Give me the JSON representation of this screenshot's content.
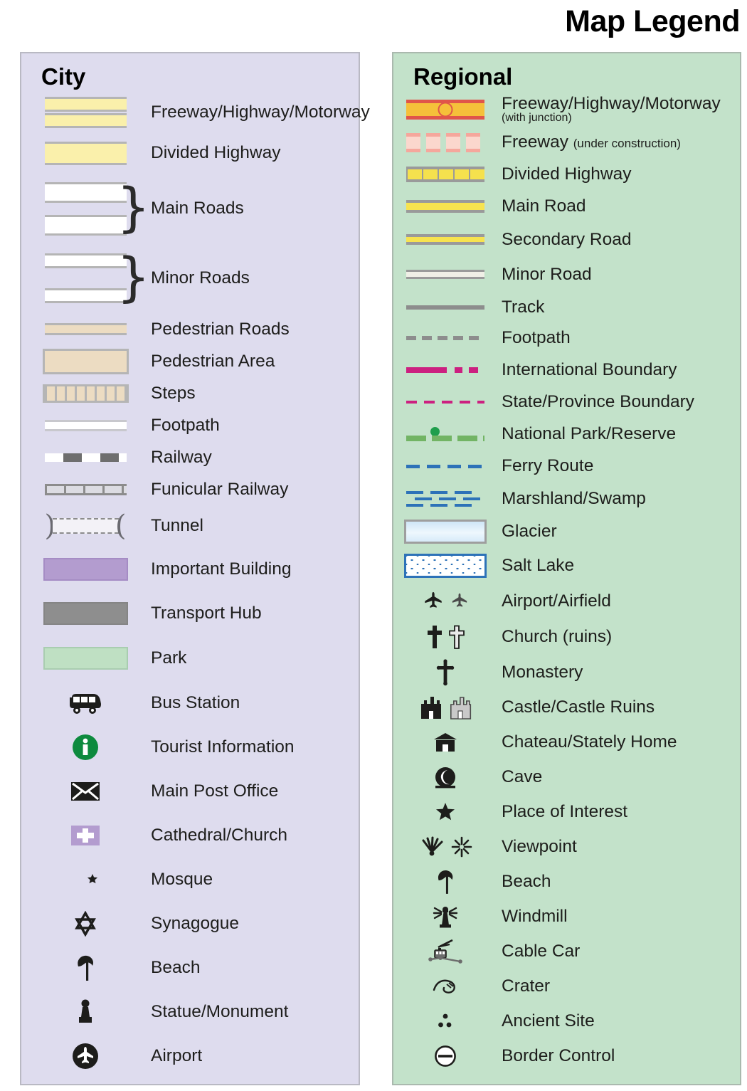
{
  "title": "Map Legend",
  "city": {
    "heading": "City",
    "bg_color": "#dedcee",
    "items": [
      {
        "label": "Freeway/Highway/Motorway",
        "symbol": "freeway-double-band"
      },
      {
        "label": "Divided Highway",
        "symbol": "divided-highway-band"
      },
      {
        "label": "Main Roads",
        "symbol": "main-roads-braced-pair"
      },
      {
        "label": "Minor Roads",
        "symbol": "minor-roads-braced-pair"
      },
      {
        "label": "Pedestrian Roads",
        "symbol": "pedestrian-road-band"
      },
      {
        "label": "Pedestrian Area",
        "symbol": "pedestrian-area-swatch"
      },
      {
        "label": "Steps",
        "symbol": "steps-hatched-band"
      },
      {
        "label": "Footpath",
        "symbol": "footpath-thin-line"
      },
      {
        "label": "Railway",
        "symbol": "railway-dashed-band"
      },
      {
        "label": "Funicular Railway",
        "symbol": "funicular-ticked-line"
      },
      {
        "label": "Tunnel",
        "symbol": "tunnel-bracket-dashed"
      },
      {
        "label": "Important Building",
        "symbol": "important-building-swatch"
      },
      {
        "label": "Transport Hub",
        "symbol": "transport-hub-swatch"
      },
      {
        "label": "Park",
        "symbol": "park-swatch"
      },
      {
        "label": "Bus Station",
        "symbol": "bus-icon"
      },
      {
        "label": "Tourist Information",
        "symbol": "information-icon"
      },
      {
        "label": "Main Post Office",
        "symbol": "envelope-icon"
      },
      {
        "label": "Cathedral/Church",
        "symbol": "cathedral-cross-icon"
      },
      {
        "label": "Mosque",
        "symbol": "crescent-star-icon"
      },
      {
        "label": "Synagogue",
        "symbol": "star-of-david-icon"
      },
      {
        "label": "Beach",
        "symbol": "parasol-icon"
      },
      {
        "label": "Statue/Monument",
        "symbol": "statue-icon"
      },
      {
        "label": "Airport",
        "symbol": "airport-circle-icon"
      }
    ]
  },
  "regional": {
    "heading": "Regional",
    "bg_color": "#c3e2ca",
    "items": [
      {
        "label": "Freeway/Highway/Motorway",
        "sublabel": "(with junction)",
        "sub_style": "below",
        "symbol": "freeway-junction-line"
      },
      {
        "label": "Freeway",
        "sublabel": "(under construction)",
        "sub_style": "inline",
        "symbol": "freeway-construction-dashes"
      },
      {
        "label": "Divided Highway",
        "symbol": "divided-highway-line"
      },
      {
        "label": "Main Road",
        "symbol": "main-road-line"
      },
      {
        "label": "Secondary Road",
        "symbol": "secondary-road-line"
      },
      {
        "label": "Minor Road",
        "symbol": "minor-road-line"
      },
      {
        "label": "Track",
        "symbol": "track-line"
      },
      {
        "label": "Footpath",
        "symbol": "footpath-dashed-line"
      },
      {
        "label": "International Boundary",
        "symbol": "international-boundary-line"
      },
      {
        "label": "State/Province Boundary",
        "symbol": "state-boundary-dashed-line"
      },
      {
        "label": "National Park/Reserve",
        "symbol": "national-park-line"
      },
      {
        "label": "Ferry Route",
        "symbol": "ferry-route-dashed-line"
      },
      {
        "label": "Marshland/Swamp",
        "symbol": "marshland-pattern"
      },
      {
        "label": "Glacier",
        "symbol": "glacier-swatch"
      },
      {
        "label": "Salt Lake",
        "symbol": "salt-lake-swatch"
      },
      {
        "label": "Airport/Airfield",
        "symbol": "airplane-pair-icon"
      },
      {
        "label": "Church (ruins)",
        "symbol": "cross-pair-icon"
      },
      {
        "label": "Monastery",
        "symbol": "monastery-cross-icon"
      },
      {
        "label": "Castle/Castle Ruins",
        "symbol": "castle-pair-icon"
      },
      {
        "label": "Chateau/Stately Home",
        "symbol": "chateau-icon"
      },
      {
        "label": "Cave",
        "symbol": "cave-icon"
      },
      {
        "label": "Place of Interest",
        "symbol": "star-icon"
      },
      {
        "label": "Viewpoint",
        "symbol": "viewpoint-pair-icon"
      },
      {
        "label": "Beach",
        "symbol": "parasol-icon"
      },
      {
        "label": "Windmill",
        "symbol": "windmill-icon"
      },
      {
        "label": "Cable Car",
        "symbol": "cable-car-icon"
      },
      {
        "label": "Crater",
        "symbol": "crater-icon"
      },
      {
        "label": "Ancient Site",
        "symbol": "ancient-site-icon"
      },
      {
        "label": "Border Control",
        "symbol": "border-control-icon"
      }
    ]
  }
}
